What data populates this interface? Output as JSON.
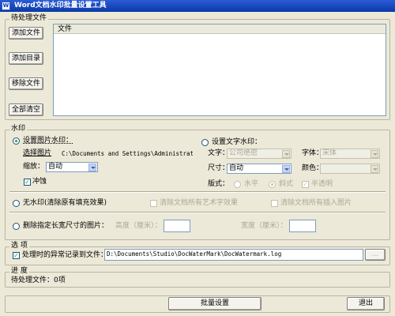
{
  "window": {
    "title": "Word文档水印批量设置工具",
    "icon": "W"
  },
  "pending": {
    "group_title": "待处理文件",
    "buttons": {
      "add_file": "添加文件",
      "add_dir": "添加目录",
      "remove_file": "移除文件",
      "clear_all": "全部清空"
    },
    "list_header": "文件"
  },
  "watermark": {
    "group_title": "水印",
    "image": {
      "option_label": "设置图片水印：",
      "choose_label": "选择图片",
      "path": "C:\\Documents and Settings\\Administrat",
      "scale_label": "缩放：",
      "scale_value": "自动",
      "washout_label": "冲蚀"
    },
    "text": {
      "option_label": "设置文字水印：",
      "text_label": "文字：",
      "text_value": "公司绝密",
      "font_label": "字体：",
      "font_value": "宋体",
      "size_label": "尺寸：",
      "size_value": "自动",
      "color_label": "颜色：",
      "color_value": "",
      "layout_label": "版式：",
      "horizontal_label": "水平",
      "diagonal_label": "斜式",
      "semitransparent_label": "半透明"
    },
    "none": {
      "option_label": "无水印(清除原有填充效果)",
      "clear_art_label": "清除文档所有艺术字效果",
      "clear_image_label": "清除文档所有插入图片"
    },
    "delete_size": {
      "option_label": "删除指定长宽尺寸的图片：",
      "height_label": "高度（厘米）：",
      "width_label": "宽度（厘米）："
    }
  },
  "options": {
    "group_title": "选  项",
    "log_label": "处理时的异常记录到文件：",
    "log_path": "D:\\Documents\\Studio\\DocWaterMark\\DocWatermark.log",
    "browse_label": "..."
  },
  "progress": {
    "group_title": "进  度",
    "status": "待处理文件：0项"
  },
  "footer": {
    "batch_button": "批量设置",
    "exit_button": "退出"
  }
}
